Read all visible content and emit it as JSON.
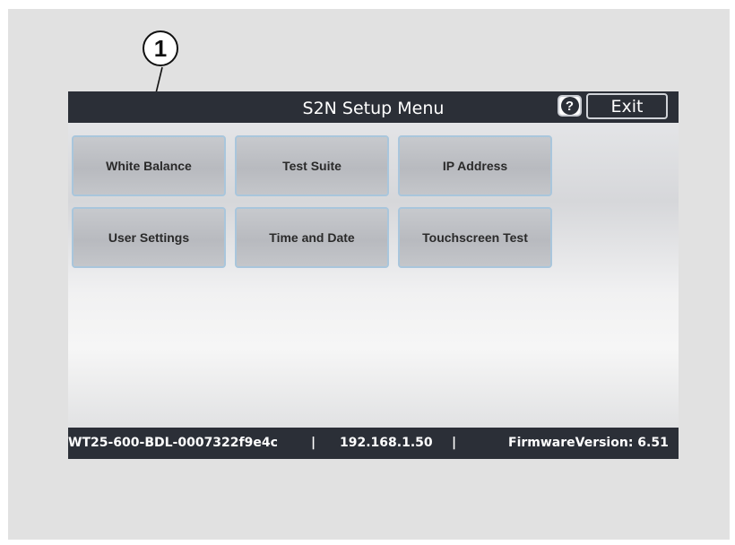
{
  "callout": {
    "number": "1"
  },
  "titlebar": {
    "title": "S2N Setup Menu",
    "help_label": "?",
    "exit_label": "Exit"
  },
  "menu": {
    "buttons": [
      {
        "label": "White Balance"
      },
      {
        "label": "Test Suite"
      },
      {
        "label": "IP Address"
      },
      {
        "label": "User Settings"
      },
      {
        "label": "Time and Date"
      },
      {
        "label": "Touchscreen Test"
      }
    ]
  },
  "status": {
    "device_id": "WT25-600-BDL-0007322f9e4c",
    "separator": "|",
    "ip": "192.168.1.50",
    "firmware": "FirmwareVersion: 6.51"
  }
}
